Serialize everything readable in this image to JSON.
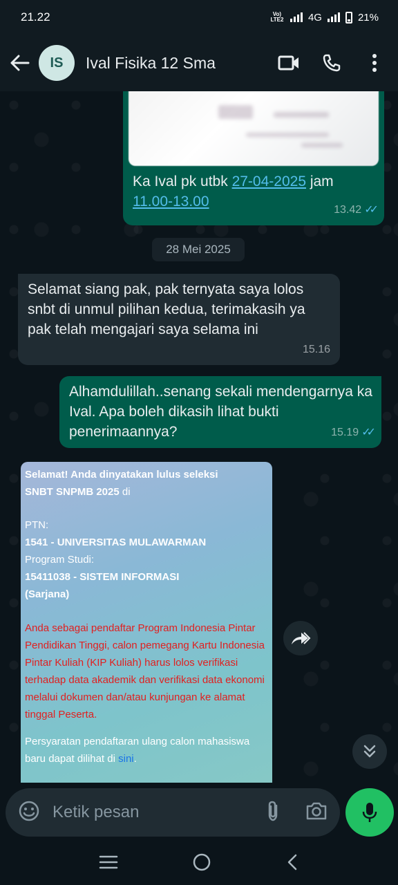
{
  "status_bar": {
    "time": "21.22",
    "volte": "Vo) LTE2",
    "network": "4G",
    "battery": "21%"
  },
  "header": {
    "avatar_initials": "IS",
    "contact_name": "Ival Fisika 12 Sma"
  },
  "messages": {
    "m1": {
      "text_before": "Ka Ival pk utbk ",
      "link_date": "27-04-2025",
      "text_middle": " jam",
      "link_time": "11.00-13.00",
      "time": "13.42"
    },
    "date_chip": "28 Mei 2025",
    "m2": {
      "text": "Selamat siang pak, pak ternyata saya lolos snbt di unmul pilihan kedua, terimakasih ya pak telah mengajari saya selama ini",
      "time": "15.16"
    },
    "m3": {
      "text": "Alhamdulillah..senang sekali mendengarnya ka Ival. Apa boleh dikasih lihat bukti penerimaannya?",
      "time": "15.19"
    }
  },
  "screenshot": {
    "line1": "Selamat! Anda dinyatakan lulus seleksi",
    "line2_bold": "SNBT SNPMB 2025",
    "line2_rest": " di",
    "ptn_label": "PTN:",
    "ptn_value": "1541 - UNIVERSITAS MULAWARMAN",
    "prodi_label": "Program Studi:",
    "prodi_value": "15411038 - SISTEM INFORMASI",
    "prodi_level": "(Sarjana)",
    "kip_notice": "Anda sebagai pendaftar Program Indonesia Pintar Pendidikan Tinggi, calon pemegang Kartu Indonesia Pintar Kuliah (KIP Kuliah) harus lolos verifikasi terhadap data akademik dan verifikasi data ekonomi melalui dokumen dan/atau kunjungan ke alamat tinggal Peserta.",
    "requirements_text": "Persyaratan pendaftaran ulang calon mahasiswa baru dapat dilihat di ",
    "requirements_link": "sini",
    "requirements_end": "."
  },
  "input": {
    "placeholder": "Ketik pesan"
  },
  "colors": {
    "outgoing_bubble": "#005c4b",
    "incoming_bubble": "#202c33",
    "accent_green": "#21c063",
    "link_blue": "#53bdeb",
    "background": "#0b141a"
  },
  "icons": [
    "back-arrow-icon",
    "video-call-icon",
    "phone-icon",
    "more-vert-icon",
    "double-check-icon",
    "forward-icon",
    "scroll-down-icon",
    "emoji-icon",
    "attach-icon",
    "camera-icon",
    "mic-icon",
    "menu-icon",
    "home-icon",
    "back-nav-icon"
  ]
}
